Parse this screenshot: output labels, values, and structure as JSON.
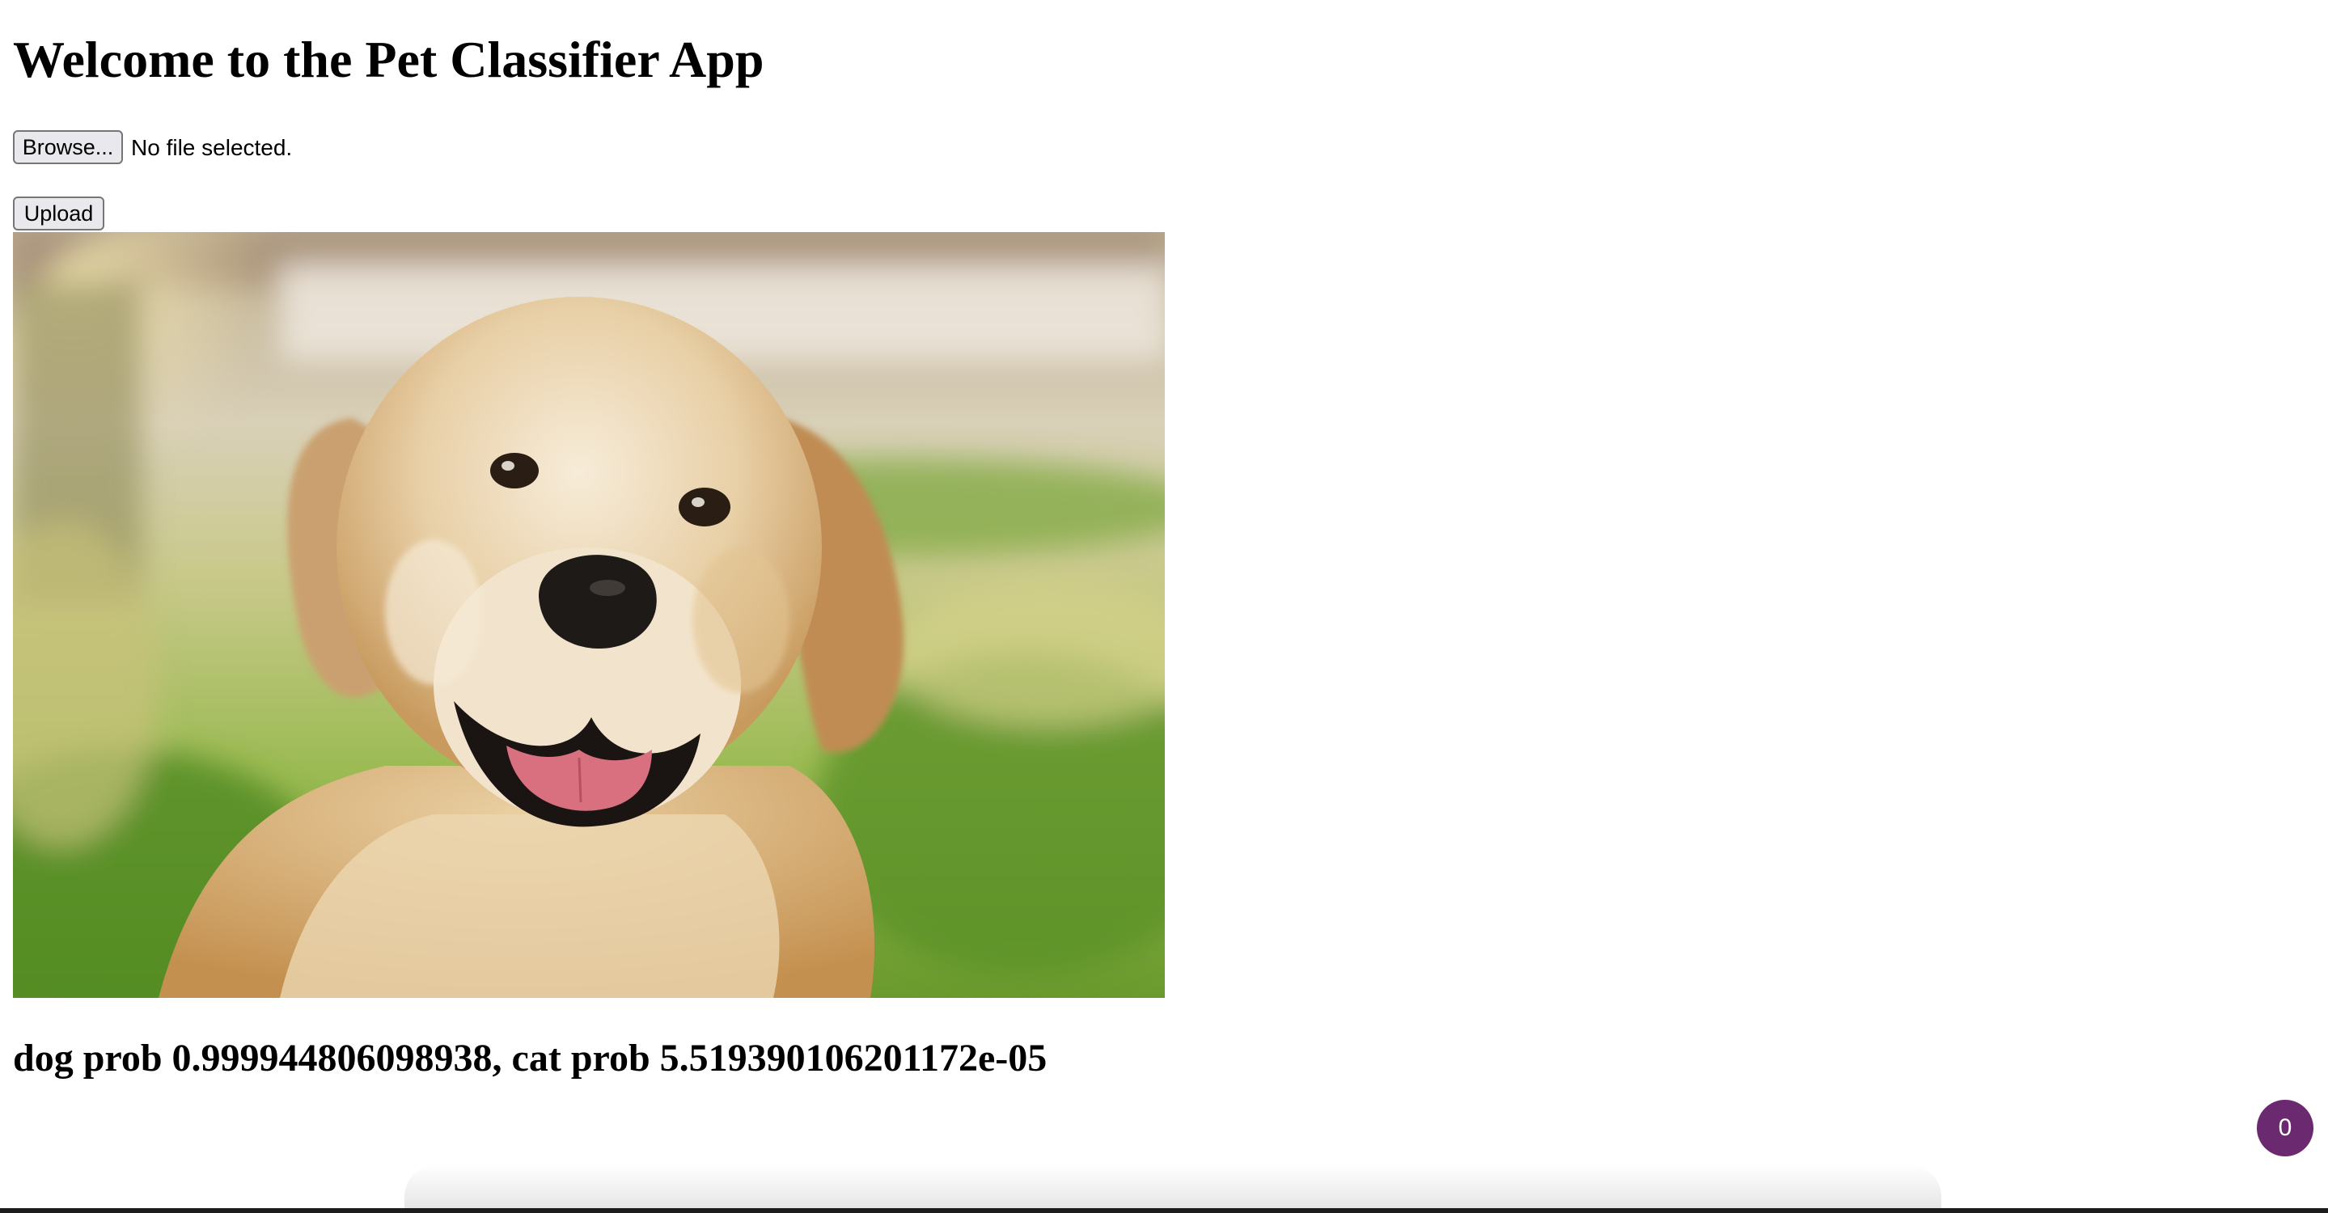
{
  "page": {
    "title": "Welcome to the Pet Classifier App"
  },
  "file_input": {
    "browse_label": "Browse...",
    "status_text": "No file selected."
  },
  "upload": {
    "label": "Upload"
  },
  "image": {
    "subject": "golden retriever dog smiling on grass"
  },
  "result": {
    "text": "dog prob 0.999944806098938, cat prob 5.519390106201172e-05"
  },
  "badge": {
    "count": "0",
    "color": "#6b2a6f"
  }
}
